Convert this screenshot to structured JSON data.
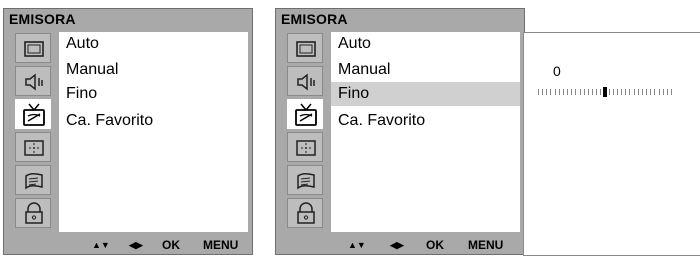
{
  "panels": [
    {
      "title": "EMISORA",
      "icons": [
        {
          "name": "screen-icon",
          "active": false
        },
        {
          "name": "speaker-icon",
          "active": false
        },
        {
          "name": "tv-antenna-icon",
          "active": true
        },
        {
          "name": "clock-icon",
          "active": false
        },
        {
          "name": "option-icon",
          "active": false
        },
        {
          "name": "lock-icon",
          "active": false
        }
      ],
      "menu": [
        {
          "label": "Auto",
          "selected": false
        },
        {
          "label": "Manual",
          "selected": false
        },
        {
          "label": "Fino",
          "selected": false
        },
        {
          "label": "Ca. Favorito",
          "selected": false
        }
      ],
      "nav": {
        "updown": "▲▼",
        "leftright": "◀▶",
        "ok": "OK",
        "menu": "MENU"
      }
    },
    {
      "title": "EMISORA",
      "icons": [
        {
          "name": "screen-icon",
          "active": false
        },
        {
          "name": "speaker-icon",
          "active": false
        },
        {
          "name": "tv-antenna-icon",
          "active": true
        },
        {
          "name": "clock-icon",
          "active": false
        },
        {
          "name": "option-icon",
          "active": false
        },
        {
          "name": "lock-icon",
          "active": false
        }
      ],
      "menu": [
        {
          "label": "Auto",
          "selected": false
        },
        {
          "label": "Manual",
          "selected": false
        },
        {
          "label": "Fino",
          "selected": true
        },
        {
          "label": "Ca. Favorito",
          "selected": false
        }
      ],
      "nav": {
        "updown": "▲▼",
        "leftright": "◀▶",
        "ok": "OK",
        "menu": "MENU"
      }
    }
  ],
  "fine_tune": {
    "value_label": "0",
    "value": 0,
    "min": -16,
    "max": 16
  }
}
